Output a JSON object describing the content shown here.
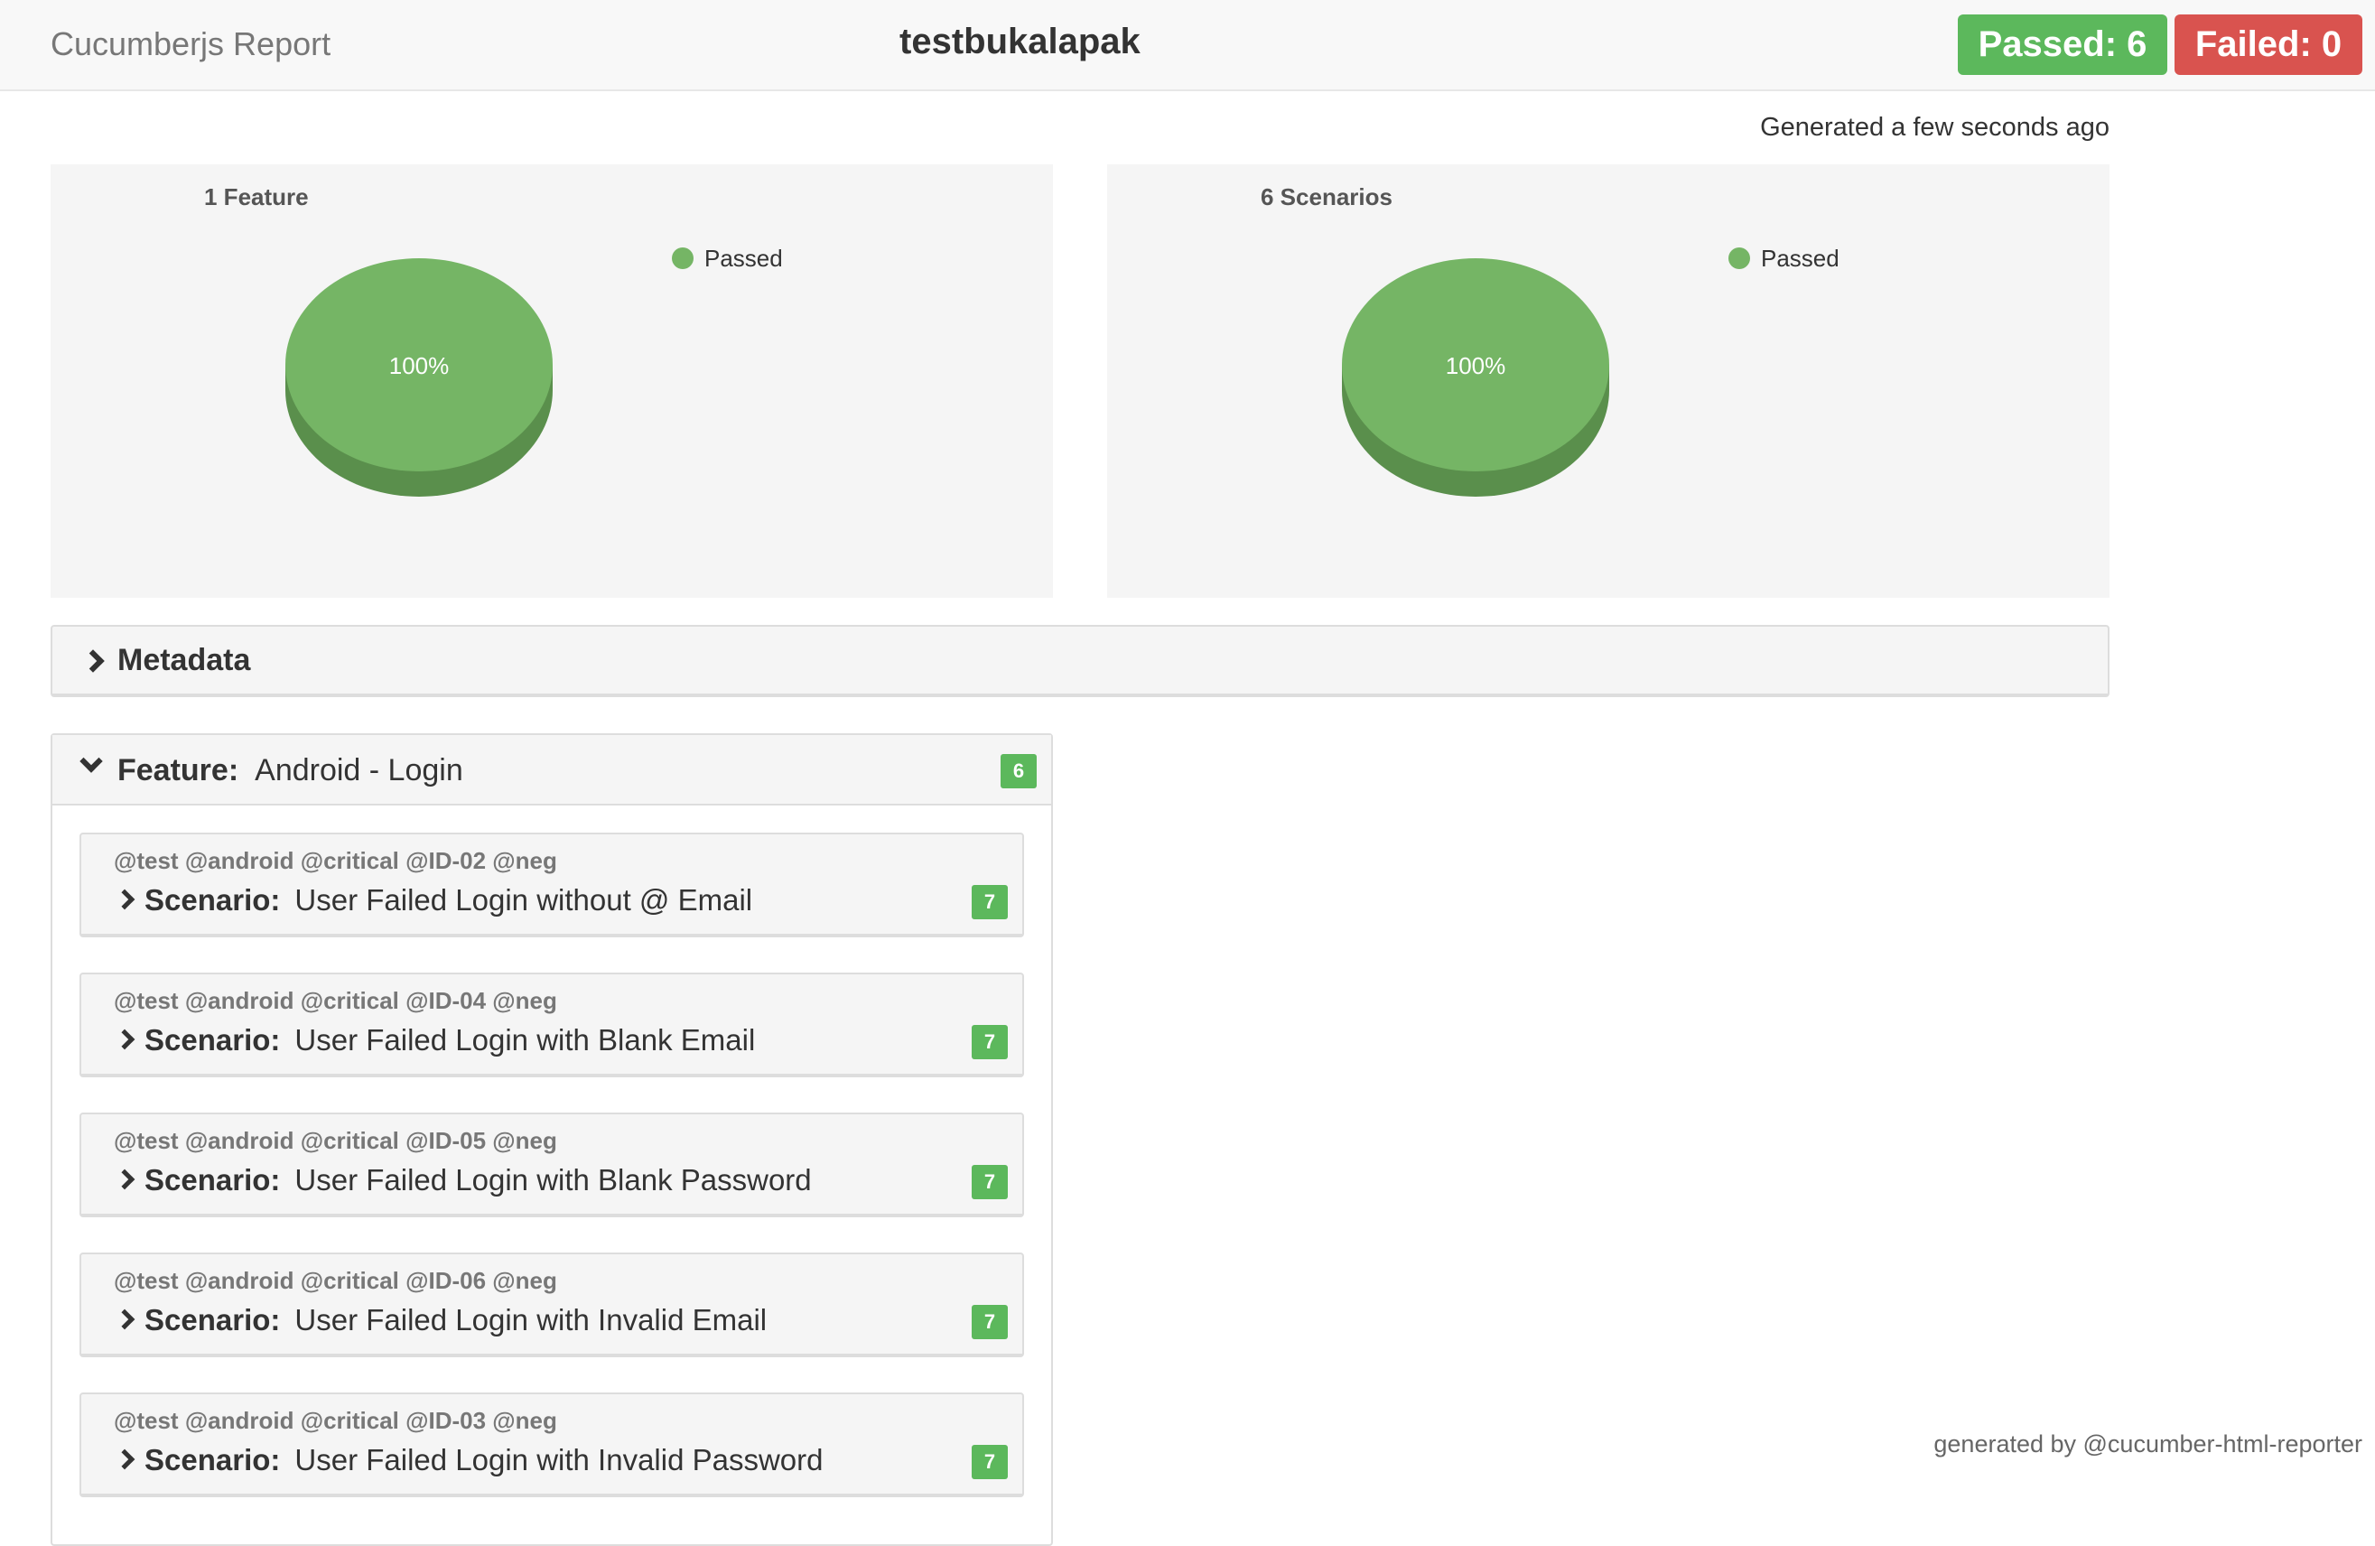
{
  "navbar": {
    "brand": "Cucumberjs Report",
    "project_title": "testbukalapak",
    "passed_badge": "Passed: 6",
    "failed_badge": "Failed: 0"
  },
  "generated_text": "Generated a few seconds ago",
  "colors": {
    "passed": "#5cb85c",
    "failed": "#d9534f",
    "pie_top": "#75b565",
    "pie_side": "#5a8f4c"
  },
  "chart_data": [
    {
      "type": "pie",
      "title": "1 Feature",
      "categories": [
        "Passed"
      ],
      "values": [
        100
      ],
      "data_labels": [
        "100%"
      ],
      "legend": [
        "Passed"
      ],
      "legend_placement": "top-right"
    },
    {
      "type": "pie",
      "title": "6 Scenarios",
      "categories": [
        "Passed"
      ],
      "values": [
        100
      ],
      "data_labels": [
        "100%"
      ],
      "legend": [
        "Passed"
      ],
      "legend_placement": "top-right"
    }
  ],
  "metadata": {
    "title": "Metadata"
  },
  "feature": {
    "keyword": "Feature:",
    "name": "Android - Login",
    "count": "6",
    "scenarios": [
      {
        "tags": "@test @android @critical @ID-02 @neg",
        "keyword": "Scenario:",
        "name": "User Failed Login without @ Email",
        "count": "7"
      },
      {
        "tags": "@test @android @critical @ID-04 @neg",
        "keyword": "Scenario:",
        "name": "User Failed Login with Blank Email",
        "count": "7"
      },
      {
        "tags": "@test @android @critical @ID-05 @neg",
        "keyword": "Scenario:",
        "name": "User Failed Login with Blank Password",
        "count": "7"
      },
      {
        "tags": "@test @android @critical @ID-06 @neg",
        "keyword": "Scenario:",
        "name": "User Failed Login with Invalid Email",
        "count": "7"
      },
      {
        "tags": "@test @android @critical @ID-03 @neg",
        "keyword": "Scenario:",
        "name": "User Failed Login with Invalid Password",
        "count": "7"
      }
    ]
  },
  "footer": "generated by @cucumber-html-reporter"
}
